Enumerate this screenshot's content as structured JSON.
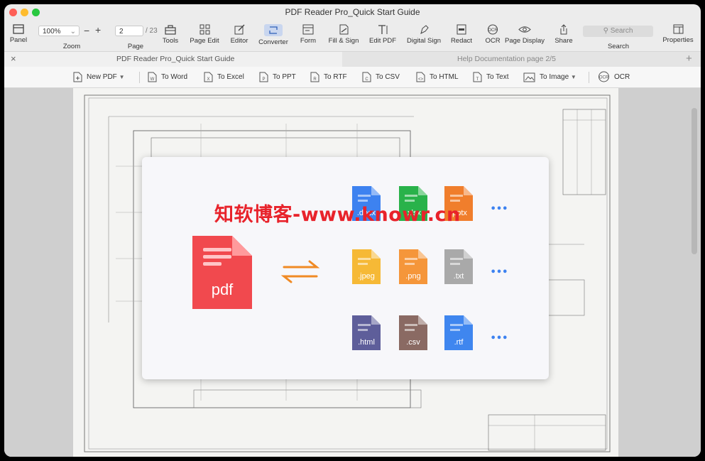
{
  "window": {
    "title": "PDF Reader Pro_Quick Start Guide"
  },
  "toolbar": {
    "panel": "Panel",
    "zoom_value": "100%",
    "zoom": "Zoom",
    "page_value": "2",
    "page_total": "/ 23",
    "page": "Page",
    "tools": "Tools",
    "page_edit": "Page Edit",
    "editor": "Editor",
    "converter": "Converter",
    "form": "Form",
    "fill_sign": "Fill & Sign",
    "edit_pdf": "Edit PDF",
    "digital_sign": "Digital Sign",
    "redact": "Redact",
    "ocr": "OCR",
    "page_display": "Page Display",
    "share": "Share",
    "search_placeholder": "Search",
    "search": "Search",
    "properties": "Properties"
  },
  "tabs": [
    {
      "label": "PDF Reader Pro_Quick Start Guide"
    },
    {
      "label": "Help Documentation   page 2/5"
    }
  ],
  "converter_bar": {
    "new_pdf": "New PDF",
    "to_word": "To Word",
    "to_excel": "To Excel",
    "to_ppt": "To PPT",
    "to_rtf": "To RTF",
    "to_csv": "To CSV",
    "to_html": "To HTML",
    "to_text": "To Text",
    "to_image": "To Image",
    "ocr": "OCR"
  },
  "content": {
    "pdf_label": "pdf",
    "file_types": [
      {
        "label": ".docx",
        "color": "#3d82f0"
      },
      {
        "label": ".xlsx",
        "color": "#29b24a"
      },
      {
        "label": ".pptx",
        "color": "#f07e2c"
      },
      {
        "label": ".jpeg",
        "color": "#f6b936"
      },
      {
        "label": ".png",
        "color": "#f5963a"
      },
      {
        "label": ".txt",
        "color": "#a9a9a9"
      },
      {
        "label": ".html",
        "color": "#5e5e9a"
      },
      {
        "label": ".csv",
        "color": "#8a6a63"
      },
      {
        "label": ".rtf",
        "color": "#3f86ef"
      }
    ],
    "more": "•••",
    "watermark": "知软博客-www.knowr.cn"
  },
  "colors": {
    "pdf_red": "#f1494e",
    "arrow_orange": "#f08a24",
    "accent_blue": "#3d82f0"
  }
}
